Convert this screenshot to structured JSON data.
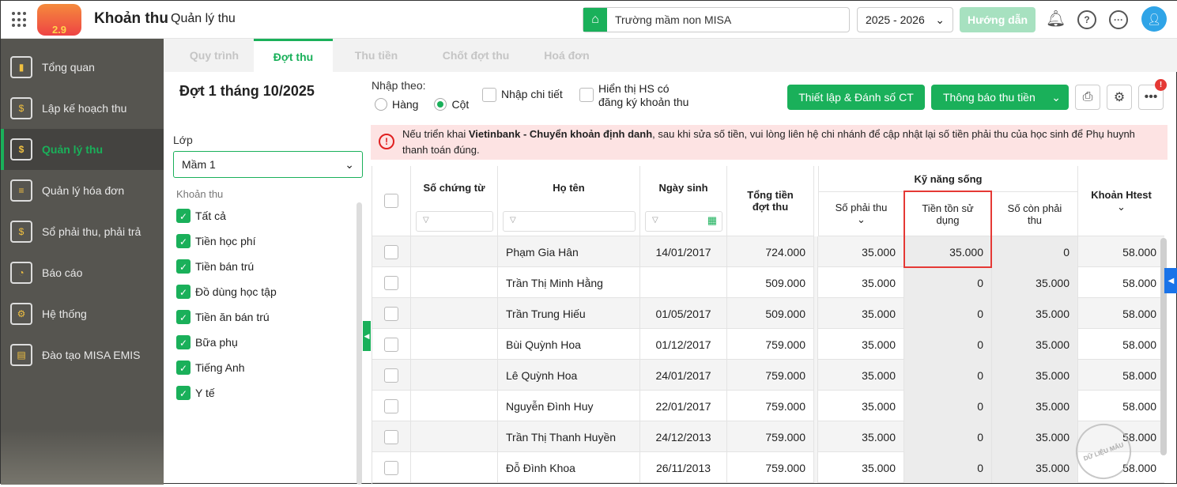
{
  "header": {
    "app_title": "Khoản thu",
    "app_subtitle": "Quản lý thu",
    "logo_text": "2.9",
    "school": "Trường mầm non MISA",
    "year": "2025 - 2026",
    "guide_label": "Hướng dẫn"
  },
  "sidebar": {
    "items": [
      {
        "label": "Tổng quan",
        "icon": "chart-icon"
      },
      {
        "label": "Lập kế hoạch thu",
        "icon": "calendar-dollar-icon"
      },
      {
        "label": "Quản lý thu",
        "icon": "money-hand-icon",
        "active": true
      },
      {
        "label": "Quản lý hóa đơn",
        "icon": "invoice-icon"
      },
      {
        "label": "Sổ phải thu, phải trả",
        "icon": "book-icon"
      },
      {
        "label": "Báo cáo",
        "icon": "pie-icon"
      },
      {
        "label": "Hệ thống",
        "icon": "gear-icon"
      },
      {
        "label": "Đào tạo MISA EMIS",
        "icon": "open-book-icon"
      }
    ]
  },
  "tabs": [
    "Quy trình",
    "Đợt thu",
    "Thu tiền",
    "Chốt đợt thu",
    "Hoá đơn"
  ],
  "left": {
    "title": "Đợt 1 tháng 10/2025",
    "class_label": "Lớp",
    "class_value": "Mầm 1",
    "fees_label": "Khoản thu",
    "fees": [
      "Tất cả",
      "Tiền học phí",
      "Tiền bán trú",
      "Đồ dùng học tập",
      "Tiền ăn bán trú",
      "Bữa phụ",
      "Tiếng Anh",
      "Y tế"
    ]
  },
  "toolbar": {
    "input_by": "Nhập theo:",
    "row_opt": "Hàng",
    "col_opt": "Cột",
    "detail": "Nhập chi tiết",
    "show_hs_1": "Hiển thị HS có",
    "show_hs_2": "đăng ký khoản thu",
    "setup_btn": "Thiết lập & Đánh số CT",
    "notify_btn": "Thông báo thu tiền",
    "badge": "!"
  },
  "alert": {
    "prefix": "Nếu triển khai ",
    "bold": "Vietinbank - Chuyển khoản định danh",
    "suffix": ", sau khi sửa số tiền, vui lòng liên hệ chi nhánh để cập nhật lại số tiền phải thu của học sinh để Phụ huynh thanh toán đúng."
  },
  "table": {
    "headers": {
      "doc_no": "Số chứng từ",
      "name": "Họ tên",
      "dob": "Ngày sinh",
      "total_1": "Tổng tiền",
      "total_2": "đợt thu",
      "group": "Kỹ năng sống",
      "payable": "Số phải thu",
      "used_1": "Tiền tồn sử",
      "used_2": "dụng",
      "remain_1": "Số còn phải",
      "remain_2": "thu",
      "htest": "Khoản Htest"
    },
    "rows": [
      {
        "name": "Phạm Gia Hân",
        "dob": "14/01/2017",
        "total": "724.000",
        "payable": "35.000",
        "used": "35.000",
        "remain": "0",
        "htest": "58.000"
      },
      {
        "name": "Trần Thị Minh Hằng",
        "dob": "",
        "total": "509.000",
        "payable": "35.000",
        "used": "0",
        "remain": "35.000",
        "htest": "58.000"
      },
      {
        "name": "Trần Trung Hiếu",
        "dob": "01/05/2017",
        "total": "509.000",
        "payable": "35.000",
        "used": "0",
        "remain": "35.000",
        "htest": "58.000"
      },
      {
        "name": "Bùi Quỳnh Hoa",
        "dob": "01/12/2017",
        "total": "759.000",
        "payable": "35.000",
        "used": "0",
        "remain": "35.000",
        "htest": "58.000"
      },
      {
        "name": "Lê Quỳnh Hoa",
        "dob": "24/01/2017",
        "total": "759.000",
        "payable": "35.000",
        "used": "0",
        "remain": "35.000",
        "htest": "58.000"
      },
      {
        "name": "Nguyễn Đình Huy",
        "dob": "22/01/2017",
        "total": "759.000",
        "payable": "35.000",
        "used": "0",
        "remain": "35.000",
        "htest": "58.000"
      },
      {
        "name": "Trần Thị Thanh Huyền",
        "dob": "24/12/2013",
        "total": "759.000",
        "payable": "35.000",
        "used": "0",
        "remain": "35.000",
        "htest": "58.000"
      },
      {
        "name": "Đỗ Đình Khoa",
        "dob": "26/11/2013",
        "total": "759.000",
        "payable": "35.000",
        "used": "0",
        "remain": "35.000",
        "htest": "58.000"
      }
    ]
  },
  "watermark": "DỮ LIỆU MẪU"
}
